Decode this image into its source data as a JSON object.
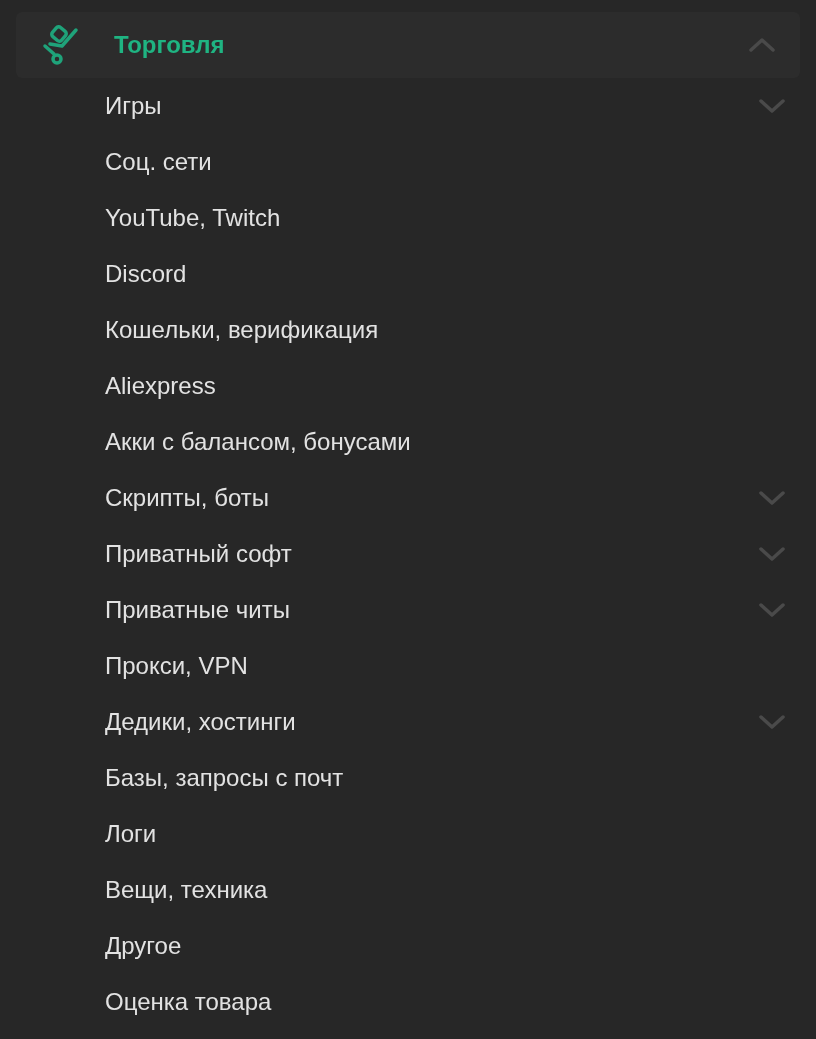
{
  "category": {
    "title": "Торговля",
    "expanded": true
  },
  "items": [
    {
      "label": "Игры",
      "has_children": true
    },
    {
      "label": "Соц. сети",
      "has_children": false
    },
    {
      "label": "YouTube, Twitch",
      "has_children": false
    },
    {
      "label": "Discord",
      "has_children": false
    },
    {
      "label": "Кошельки, верификация",
      "has_children": false
    },
    {
      "label": "Aliexpress",
      "has_children": false
    },
    {
      "label": "Акки с балансом, бонусами",
      "has_children": false
    },
    {
      "label": "Скрипты, боты",
      "has_children": true
    },
    {
      "label": "Приватный софт",
      "has_children": true
    },
    {
      "label": "Приватные читы",
      "has_children": true
    },
    {
      "label": "Прокси, VPN",
      "has_children": false
    },
    {
      "label": "Дедики, хостинги",
      "has_children": true
    },
    {
      "label": "Базы, запросы с почт",
      "has_children": false
    },
    {
      "label": "Логи",
      "has_children": false
    },
    {
      "label": "Вещи, техника",
      "has_children": false
    },
    {
      "label": "Другое",
      "has_children": false
    },
    {
      "label": "Оценка товара",
      "has_children": false
    }
  ]
}
